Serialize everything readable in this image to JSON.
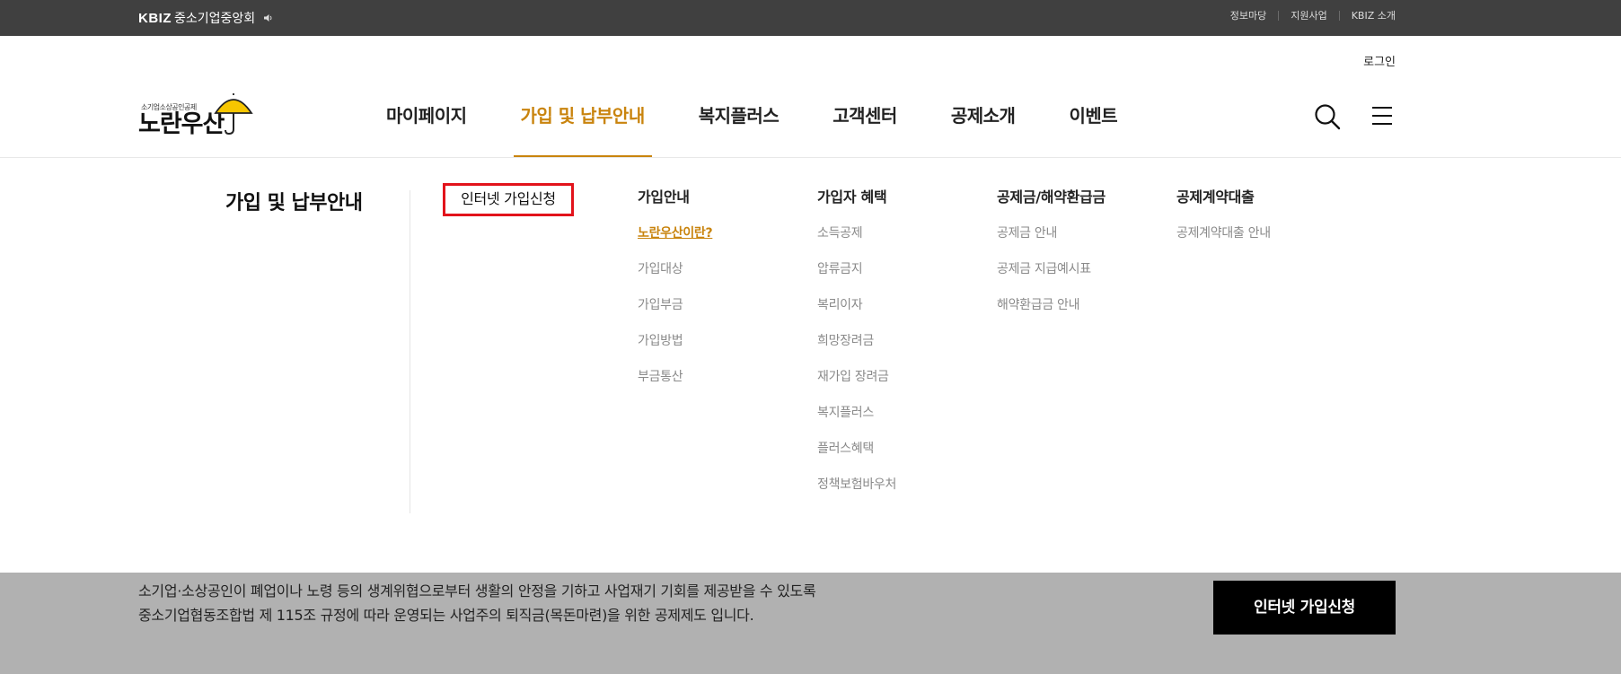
{
  "topbar": {
    "logo_mark": "KBIZ",
    "logo_name": "중소기업중앙회",
    "links": [
      "정보마당",
      "지원사업",
      "KBIZ 소개"
    ]
  },
  "header": {
    "login_label": "로그인",
    "brand_sub": "소기업소상공인공제",
    "brand_main": "노란우산",
    "nav": [
      {
        "label": "마이페이지",
        "active": false
      },
      {
        "label": "가입 및 납부안내",
        "active": true
      },
      {
        "label": "복지플러스",
        "active": false
      },
      {
        "label": "고객센터",
        "active": false
      },
      {
        "label": "공제소개",
        "active": false
      },
      {
        "label": "이벤트",
        "active": false
      }
    ]
  },
  "mega": {
    "title": "가입 및 납부안내",
    "apply_online": "인터넷 가입신청",
    "columns": [
      {
        "head": "가입안내",
        "items": [
          "노란우산이란?",
          "가입대상",
          "가입부금",
          "가입방법",
          "부금통산"
        ]
      },
      {
        "head": "가입자 혜택",
        "items": [
          "소득공제",
          "압류금지",
          "복리이자",
          "희망장려금",
          "재가입 장려금",
          "복지플러스",
          "플러스혜택",
          "정책보험바우처"
        ]
      },
      {
        "head": "공제금/해약환급금",
        "items": [
          "공제금 안내",
          "공제금 지급예시표",
          "해약환급금 안내"
        ]
      },
      {
        "head": "공제계약대출",
        "items": [
          "공제계약대출 안내"
        ]
      }
    ],
    "active_item": "노란우산이란?"
  },
  "bottom": {
    "line1": "소기업·소상공인이 폐업이나 노령 등의 생계위협으로부터 생활의 안정을 기하고 사업재기 기회를 제공받을 수 있도록",
    "line2": "중소기업협동조합법 제 115조 규정에 따라 운영되는 사업주의 퇴직금(목돈마련)을 위한 공제제도 입니다.",
    "apply_button": "인터넷 가입신청"
  },
  "colors": {
    "topbar_bg": "#404040",
    "accent": "#c9840e",
    "highlight_box": "#e2131b",
    "band_bg": "#b1b1b1",
    "button_bg": "#000000"
  }
}
